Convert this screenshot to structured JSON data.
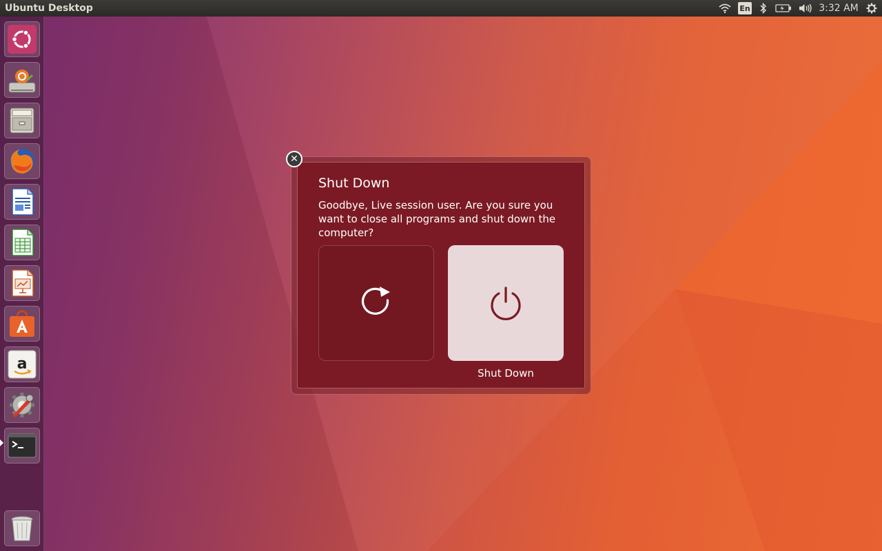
{
  "panel": {
    "title": "Ubuntu Desktop",
    "language": "En",
    "clock": "3:32 AM"
  },
  "launcher": {
    "items": [
      {
        "name": "dash-home",
        "icon": "ubuntu-logo-icon"
      },
      {
        "name": "install-ubuntu",
        "icon": "installer-icon"
      },
      {
        "name": "files",
        "icon": "file-cabinet-icon"
      },
      {
        "name": "firefox",
        "icon": "firefox-icon"
      },
      {
        "name": "libreoffice-writer",
        "icon": "writer-icon"
      },
      {
        "name": "libreoffice-calc",
        "icon": "calc-icon"
      },
      {
        "name": "libreoffice-impress",
        "icon": "impress-icon"
      },
      {
        "name": "ubuntu-software",
        "icon": "software-bag-icon"
      },
      {
        "name": "amazon",
        "icon": "amazon-icon"
      },
      {
        "name": "system-settings",
        "icon": "settings-wrench-icon"
      },
      {
        "name": "terminal",
        "icon": "terminal-icon"
      },
      {
        "name": "trash",
        "icon": "trash-icon"
      }
    ]
  },
  "dialog": {
    "title": "Shut Down",
    "message": "Goodbye, Live session user. Are you sure you want to close all programs and shut down the computer?",
    "focused_label": "Shut Down"
  },
  "colors": {
    "dialog_bg": "#7b1a24",
    "panel_bg": "#2b2a27",
    "shutdown_btn_bg": "#e8d8da",
    "power_icon": "#7b1a24"
  }
}
